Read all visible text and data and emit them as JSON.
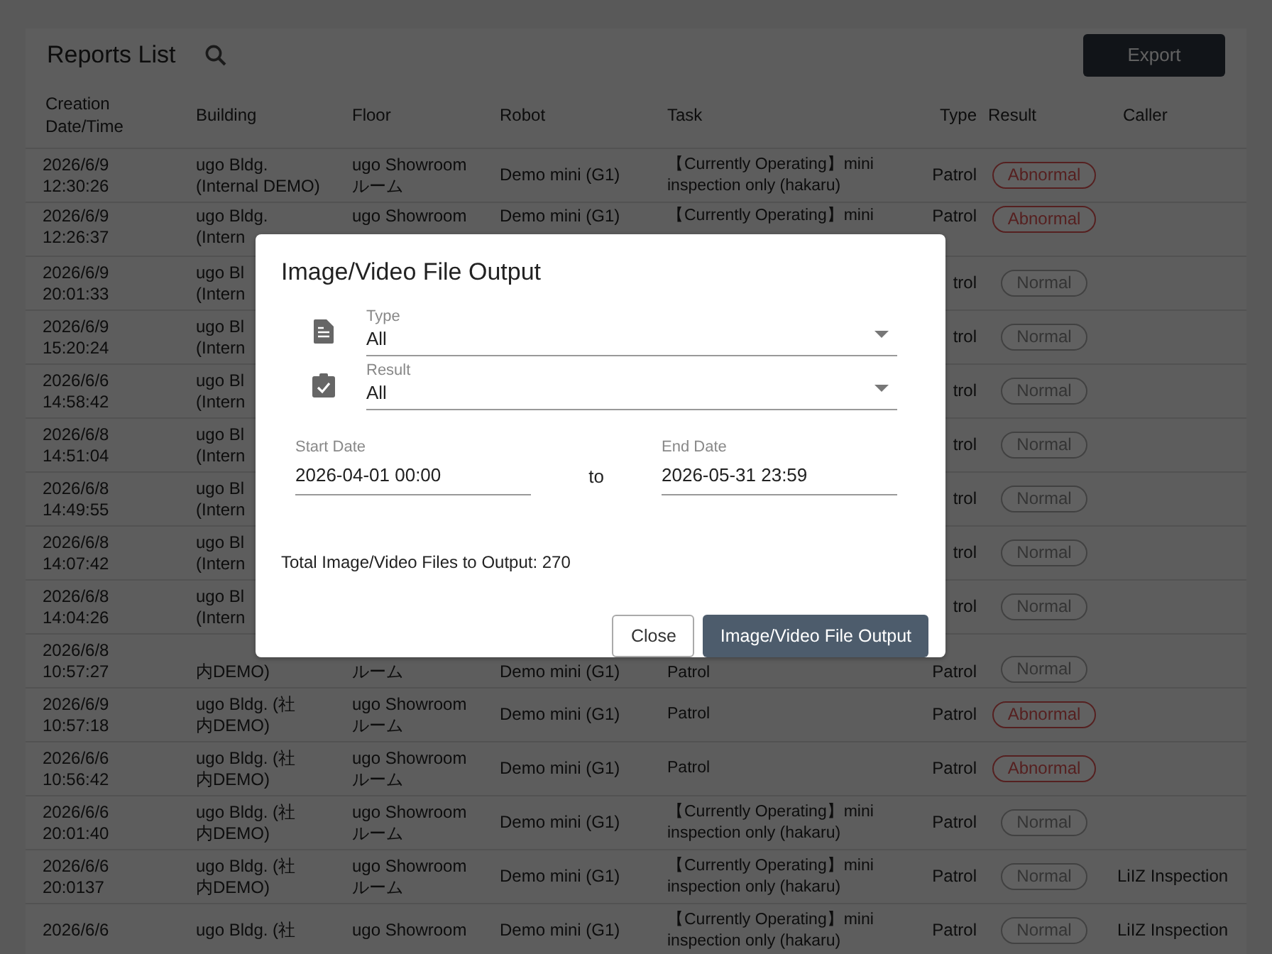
{
  "page": {
    "title": "Reports List",
    "export_button": "Export"
  },
  "table": {
    "columns": [
      "Creation\nDate/Time",
      "Building",
      "Floor",
      "Robot",
      "Task",
      "Type",
      "Result",
      "Caller"
    ],
    "rows": [
      {
        "date": "2026/6/9\n12:30:26",
        "building": "ugo Bldg.\n(Internal DEMO)",
        "floor": "ugo Showroom\nルーム",
        "robot": "Demo mini (G1)",
        "task": "【Currently Operating】mini\ninspection only (hakaru)",
        "type": "Patrol",
        "result": {
          "label": "Abnormal",
          "abnormal": true
        }
      },
      {
        "date": "2026/6/9\n12:26:37",
        "building": "ugo Bldg.\n(Intern",
        "floor": "ugo Showroom",
        "robot": "Demo mini (G1)",
        "task": "【Currently Operating】mini",
        "type": "Patrol",
        "result": {
          "label": "Abnormal",
          "abnormal": true
        }
      },
      {
        "date": "2026/6/9\n20:01:33",
        "building": "ugo Bl\n(Intern",
        "type": "trol",
        "result": {
          "label": "Normal",
          "abnormal": false
        }
      },
      {
        "date": "2026/6/9\n15:20:24",
        "building": "ugo Bl\n(Intern",
        "type": "trol",
        "result": {
          "label": "Normal",
          "abnormal": false
        }
      },
      {
        "date": "2026/6/6\n14:58:42",
        "building": "ugo Bl\n(Intern",
        "type": "trol",
        "result": {
          "label": "Normal",
          "abnormal": false
        }
      },
      {
        "date": "2026/6/8\n14:51:04",
        "building": "ugo Bl\n(Intern",
        "type": "trol",
        "result": {
          "label": "Normal",
          "abnormal": false
        }
      },
      {
        "date": "2026/6/8\n14:49:55",
        "building": "ugo Bl\n(Intern",
        "type": "trol",
        "result": {
          "label": "Normal",
          "abnormal": false
        }
      },
      {
        "date": "2026/6/8\n14:07:42",
        "building": "ugo Bl\n(Intern",
        "type": "trol",
        "result": {
          "label": "Normal",
          "abnormal": false
        }
      },
      {
        "date": "2026/6/8\n14:04:26",
        "building": "ugo Bl\n(Intern",
        "type": "trol",
        "result": {
          "label": "Normal",
          "abnormal": false
        }
      },
      {
        "date": "2026/6/8\n10:57:27",
        "building": "内DEMO)",
        "floor": "ルーム",
        "robot": "Demo mini (G1)",
        "task": "Patrol",
        "type": "Patrol",
        "result": {
          "label": "Normal",
          "abnormal": false
        }
      },
      {
        "date": "2026/6/9\n10:57:18",
        "building": "ugo Bldg. (社内DEMO)",
        "floor": "ugo Showroom\nルーム",
        "robot": "Demo mini (G1)",
        "task": "Patrol",
        "type": "Patrol",
        "result": {
          "label": "Abnormal",
          "abnormal": true
        }
      },
      {
        "date": "2026/6/6\n10:56:42",
        "building": "ugo Bldg. (社内DEMO)",
        "floor": "ugo Showroom\nルーム",
        "robot": "Demo mini (G1)",
        "task": "Patrol",
        "type": "Patrol",
        "result": {
          "label": "Abnormal",
          "abnormal": true
        }
      },
      {
        "date": "2026/6/6\n20:01:40",
        "building": "ugo Bldg. (社内DEMO)",
        "floor": "ugo Showroom\nルーム",
        "robot": "Demo mini (G1)",
        "task": "【Currently Operating】mini\ninspection only (hakaru)",
        "type": "Patrol",
        "result": {
          "label": "Normal",
          "abnormal": false
        }
      },
      {
        "date": "2026/6/6\n20:0137",
        "building": "ugo Bldg. (社内DEMO)",
        "floor": "ugo Showroom\nルーム",
        "robot": "Demo mini (G1)",
        "task": "【Currently Operating】mini\ninspection only (hakaru)",
        "type": "Patrol",
        "result": {
          "label": "Normal",
          "abnormal": false
        },
        "caller": "LiIZ Inspection"
      },
      {
        "date": "2026/6/6",
        "building": "ugo Bldg. (社",
        "floor": "ugo Showroom",
        "robot": "Demo mini (G1)",
        "task": "【Currently Operating】mini\ninspection only (hakaru)",
        "type": "Patrol",
        "result": {
          "label": "Normal",
          "abnormal": false
        },
        "caller": "LiIZ Inspection"
      }
    ]
  },
  "dialog": {
    "title": "Image/Video File Output",
    "selects": [
      {
        "kind": "document",
        "label": "Type",
        "value": "All"
      },
      {
        "kind": "clipboard",
        "label": "Result",
        "value": "All"
      }
    ],
    "start_date": {
      "label": "Start Date",
      "value": "2026-04-01 00:00"
    },
    "range_separator": "to",
    "end_date": {
      "label": "End Date",
      "value": "2026-05-31 23:59"
    },
    "total": "Total Image/Video Files to Output: 270",
    "buttons": [
      {
        "label": "Close",
        "kind": "secondary"
      },
      {
        "label": "Image/Video File Output",
        "kind": "primary"
      }
    ]
  }
}
